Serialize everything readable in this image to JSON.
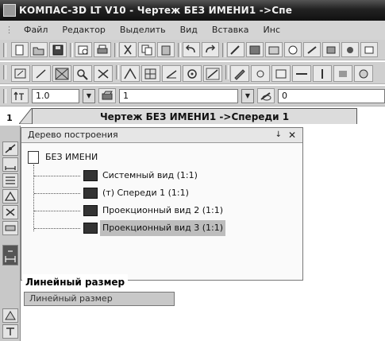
{
  "window": {
    "title": "КОМПАС-3D LT V10 - Чертеж БЕЗ ИМЕНИ1 ->Спе"
  },
  "menu": {
    "items": [
      "Файл",
      "Редактор",
      "Выделить",
      "Вид",
      "Вставка",
      "Инс"
    ]
  },
  "property_bar": {
    "scale_value": "1.0",
    "layer_value": "1",
    "style_value": "0"
  },
  "document": {
    "tab_number": "1",
    "tab_title": "Чертеж БЕЗ ИМЕНИ1 ->Спереди 1"
  },
  "tree_panel": {
    "title": "Дерево построения",
    "pin_glyph": "↓",
    "close_glyph": "✕",
    "root_label": "БЕЗ ИМЕНИ",
    "items": [
      {
        "label": "Системный вид (1:1)"
      },
      {
        "label": "(т) Спереди 1 (1:1)"
      },
      {
        "label": "Проекционный вид 2 (1:1)"
      },
      {
        "label": "Проекционный вид 3 (1:1)",
        "selected": true
      }
    ]
  },
  "tooltip": {
    "title": "Линейный размер",
    "description": "Линейный размер"
  },
  "icons": {
    "accent": "#333333",
    "selection_bg": "#bdbdbd"
  }
}
